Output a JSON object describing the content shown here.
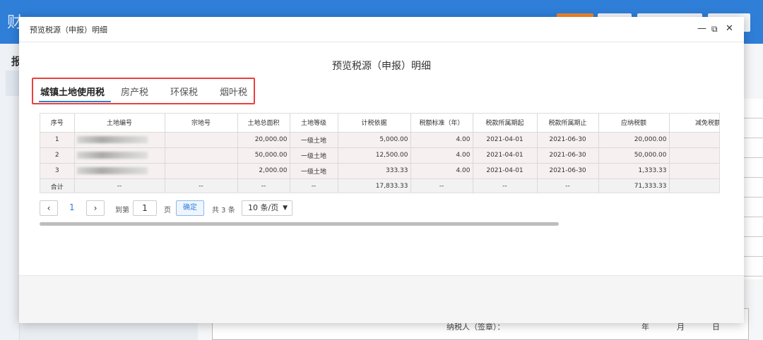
{
  "modal": {
    "title": "预览税源（申报）明细",
    "heading": "预览税源（申报）明细",
    "controls": {
      "minimize": "—",
      "maximize": "⧉",
      "close": "✕"
    }
  },
  "tabs": [
    {
      "label": "城镇土地使用税",
      "active": true
    },
    {
      "label": "房产税",
      "active": false
    },
    {
      "label": "环保税",
      "active": false
    },
    {
      "label": "烟叶税",
      "active": false
    }
  ],
  "table": {
    "headers": [
      "序号",
      "土地编号",
      "宗地号",
      "土地总面积",
      "土地等级",
      "计税依据",
      "税额标准（年）",
      "税款所属期起",
      "税款所属期止",
      "应纳税额",
      "减免税额"
    ],
    "rows": [
      [
        "1",
        "",
        "",
        "20,000.00",
        "一级土地",
        "5,000.00",
        "4.00",
        "2021-04-01",
        "2021-06-30",
        "20,000.00",
        ""
      ],
      [
        "2",
        "",
        "",
        "50,000.00",
        "一级土地",
        "12,500.00",
        "4.00",
        "2021-04-01",
        "2021-06-30",
        "50,000.00",
        ""
      ],
      [
        "3",
        "",
        "",
        "2,000.00",
        "一级土地",
        "333.33",
        "4.00",
        "2021-04-01",
        "2021-06-30",
        "1,333.33",
        ""
      ]
    ],
    "total": [
      "合计",
      "--",
      "--",
      "--",
      "--",
      "17,833.33",
      "--",
      "--",
      "--",
      "71,333.33",
      ""
    ]
  },
  "pager": {
    "prev": "‹",
    "current_page": "1",
    "next": "›",
    "goto_label": "到第",
    "goto_value": "1",
    "page_unit": "页",
    "confirm": "确定",
    "total": "共 3 条",
    "page_size": "10 条/页"
  },
  "background": {
    "title_fragment": "财",
    "left_label": "报",
    "footer_signature": "纳税人（签章）：",
    "footer_year": "年",
    "footer_month": "月",
    "footer_day": "日"
  },
  "colors": {
    "header_blue": "#2f7ed8",
    "tab_highlight_red": "#e8413d",
    "row_bg": "#f7f0f0"
  }
}
